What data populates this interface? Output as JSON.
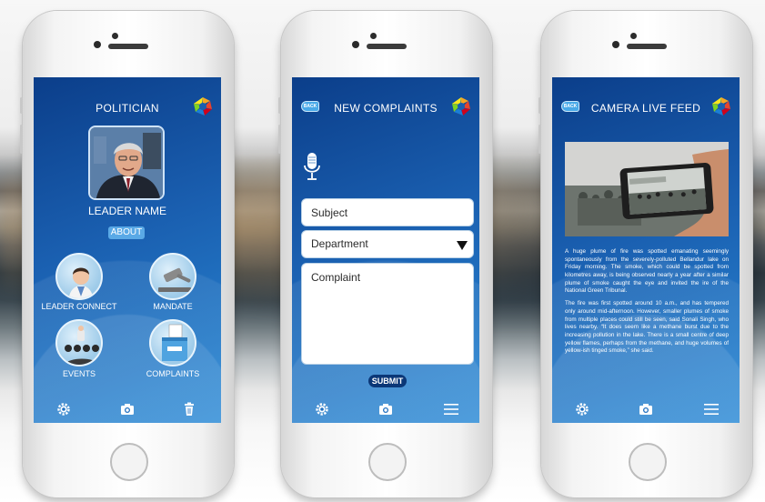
{
  "screens": {
    "politician": {
      "title": "POLITICIAN",
      "leader_name": "LEADER NAME",
      "about_label": "ABOUT",
      "tiles": [
        {
          "label": "LEADER CONNECT",
          "icon": "person-icon"
        },
        {
          "label": "MANDATE",
          "icon": "gavel-icon"
        },
        {
          "label": "EVENTS",
          "icon": "audience-icon"
        },
        {
          "label": "COMPLAINTS",
          "icon": "ballot-box-icon"
        }
      ],
      "bottom_icons": [
        "gear-icon",
        "camera-icon",
        "trash-icon"
      ]
    },
    "complaints": {
      "back_label": "BACK",
      "title": "NEW COMPLAINTS",
      "subject_placeholder": "Subject",
      "department_value": "Department",
      "complaint_placeholder": "Complaint",
      "submit_label": "SUBMIT",
      "bottom_icons": [
        "gear-icon",
        "camera-icon",
        "menu-icon"
      ]
    },
    "camera": {
      "back_label": "BACK",
      "title": "CAMERA LIVE FEED",
      "paragraphs": [
        "A huge plume of fire was spotted emanating seemingly spontaneously from the severely-polluted Bellandur lake on Friday morning. The smoke, which could be spotted from kilometres away, is being observed nearly a year after a similar plume of smoke caught the eye and invited the ire of the National Green Tribunal.",
        "The fire was first spotted around 10 a.m., and has tempered only around mid-afternoon. However, smaller plumes of smoke from multiple places could still be seen, said Sonali Singh, who lives nearby. “It does seem like a methane burst due to the increasing pollution in the lake. There is a small centre of deep yellow flames, perhaps from the methane, and huge volumes of yellow-ish tinged smoke,” she said."
      ],
      "bottom_icons": [
        "gear-icon",
        "camera-icon",
        "menu-icon"
      ]
    }
  },
  "colors": {
    "screen_dark": "#0b3e8a",
    "screen_light": "#2a8ad6",
    "accent_button": "#5aa9e6",
    "submit_button": "#0b3777"
  }
}
